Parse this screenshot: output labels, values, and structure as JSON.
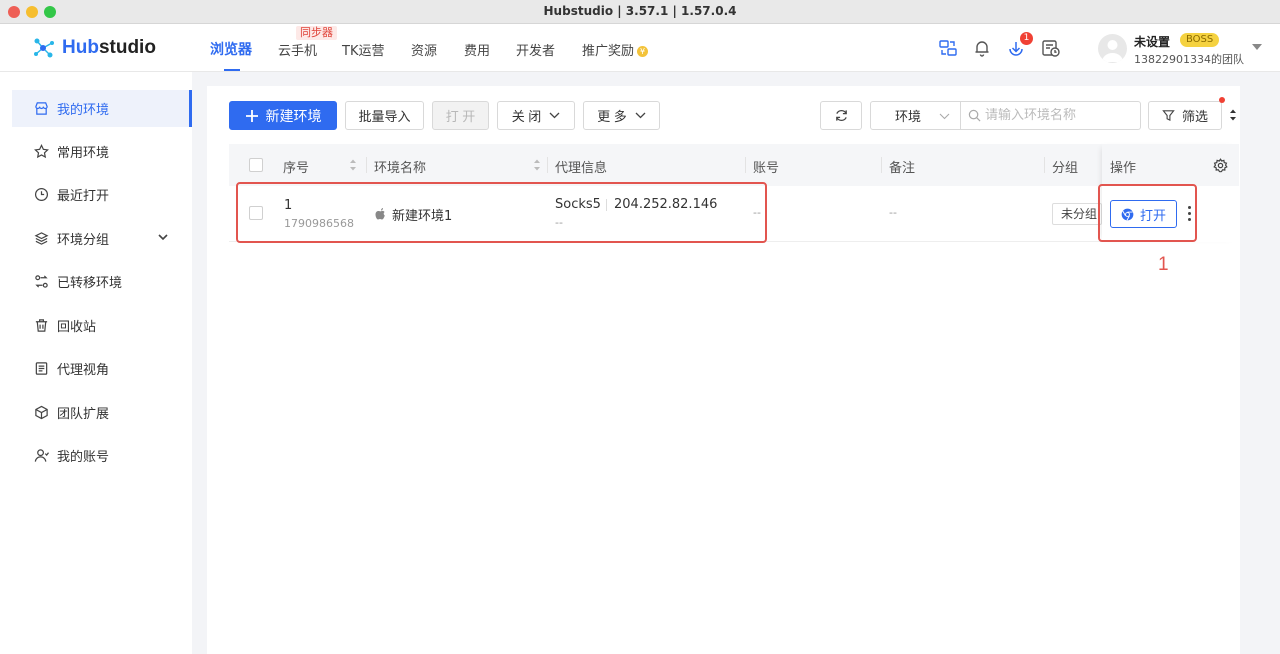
{
  "window": {
    "title": "Hubstudio | 3.57.1 | 1.57.0.4"
  },
  "header": {
    "logo_prefix": "Hub",
    "logo_suffix": "studio",
    "nav": [
      {
        "label": "浏览器",
        "active": true
      },
      {
        "label": "云手机",
        "tag": "同步器"
      },
      {
        "label": "TK运营"
      },
      {
        "label": "资源"
      },
      {
        "label": "费用"
      },
      {
        "label": "开发者"
      },
      {
        "label": "推广奖励"
      }
    ],
    "notification_badge": "1",
    "user": {
      "name": "未设置",
      "role_badge": "BOSS",
      "team": "13822901334的团队"
    }
  },
  "sidebar": {
    "items": [
      {
        "label": "我的环境",
        "icon": "store-icon",
        "active": true
      },
      {
        "label": "常用环境",
        "icon": "star-icon"
      },
      {
        "label": "最近打开",
        "icon": "clock-icon"
      },
      {
        "label": "环境分组",
        "icon": "layers-icon"
      },
      {
        "label": "已转移环境",
        "icon": "transfer-icon"
      },
      {
        "label": "回收站",
        "icon": "trash-icon"
      },
      {
        "label": "代理视角",
        "icon": "proxy-icon"
      },
      {
        "label": "团队扩展",
        "icon": "cube-icon"
      },
      {
        "label": "我的账号",
        "icon": "user-icon"
      }
    ]
  },
  "toolbar": {
    "new_env": "新建环境",
    "batch_import": "批量导入",
    "open": "打 开",
    "close": "关 闭",
    "more": "更 多",
    "env_select": "环境",
    "search_placeholder": "请输入环境名称",
    "filter": "筛选"
  },
  "table": {
    "columns": [
      "序号",
      "环境名称",
      "代理信息",
      "账号",
      "备注",
      "分组",
      "操作"
    ],
    "rows": [
      {
        "index": "1",
        "id": "1790986568",
        "name": "新建环境1",
        "proxy_type": "Socks5",
        "proxy_ip": "204.252.82.146",
        "proxy_sub": "--",
        "account": "--",
        "remark": "--",
        "group": "未分组",
        "action": "打开"
      }
    ]
  },
  "annotation": {
    "label": "1",
    "color": "#e2554f"
  },
  "colors": {
    "accent": "#2f6bf0",
    "annotation": "#e2554f"
  }
}
